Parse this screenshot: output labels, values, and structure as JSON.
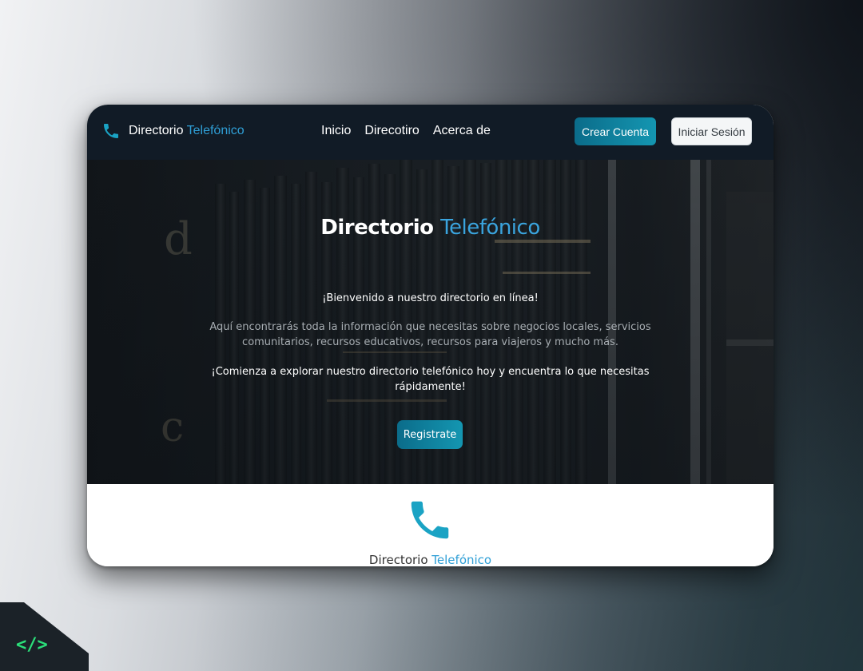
{
  "navbar": {
    "brand": {
      "icon": "phone-icon",
      "text_plain": "Directorio",
      "text_accent": "Telefónico"
    },
    "links": [
      "Inicio",
      "Direcotiro",
      "Acerca de"
    ],
    "crear_cuenta_label": "Crear Cuenta",
    "iniciar_sesion_label": "Iniciar Sesión"
  },
  "hero": {
    "title_plain": "Directorio",
    "title_accent": "Telefónico",
    "welcome": "¡Bienvenido a nuestro directorio en línea!",
    "description": "Aquí encontrarás toda la información que necesitas sobre negocios locales, servicios comunitarios, recursos educativos, recursos para viajeros y mucho más.",
    "call_to_action": "¡Comienza a explorar nuestro directorio telefónico hoy y encuentra lo que necesitas rápidamente!",
    "button_label": "Registrate",
    "background_letters": [
      "d",
      "c"
    ]
  },
  "footer": {
    "icon": "phone-icon",
    "title_plain": "Directorio",
    "title_accent": "Telefónico"
  },
  "badge": {
    "icon": "code-icon",
    "text": "</>"
  },
  "colors": {
    "accent": "#2f9fd6",
    "button_gradient_start": "#0b6c8a",
    "button_gradient_end": "#1496b1",
    "navbar": "#111b26",
    "badge_green": "#2be07a"
  }
}
